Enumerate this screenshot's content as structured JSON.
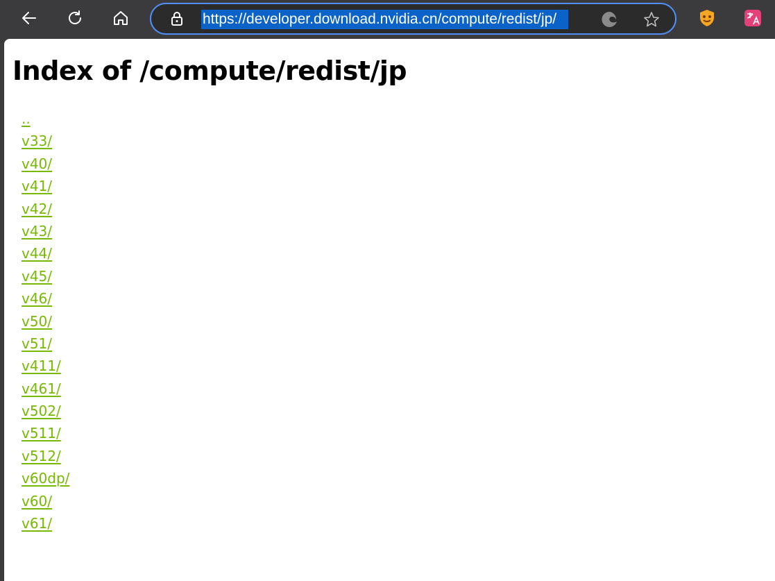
{
  "browser": {
    "url": "https://developer.download.nvidia.cn/compute/redist/jp/",
    "accent_color": "#4f8ff7",
    "selection_color": "#0b63c9"
  },
  "page": {
    "title": "Index of /compute/redist/jp",
    "link_color": "#76b900",
    "entries": [
      "..",
      "v33/",
      "v40/",
      "v41/",
      "v42/",
      "v43/",
      "v44/",
      "v45/",
      "v46/",
      "v50/",
      "v51/",
      "v411/",
      "v461/",
      "v502/",
      "v511/",
      "v512/",
      "v60dp/",
      "v60/",
      "v61/"
    ]
  }
}
